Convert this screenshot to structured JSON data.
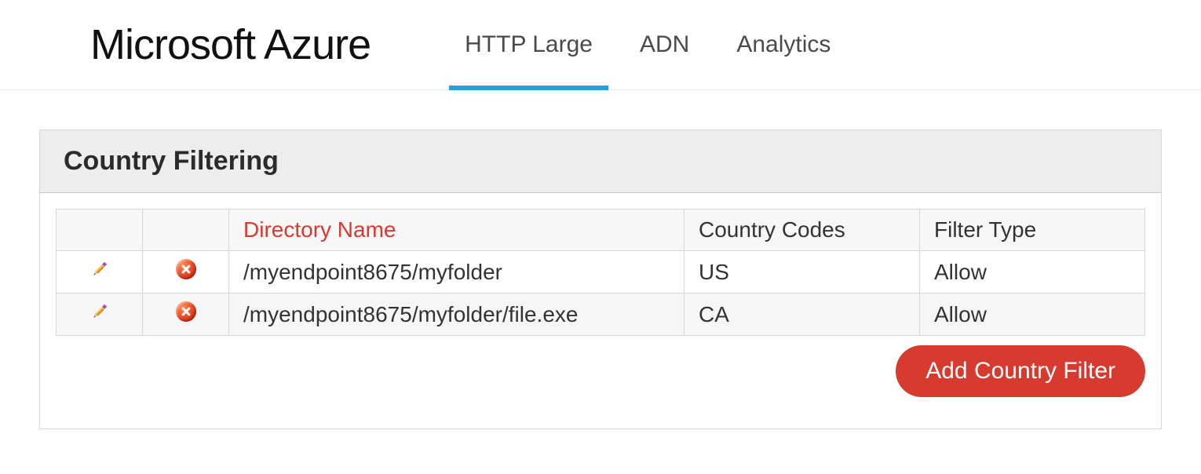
{
  "brand": "Microsoft Azure",
  "nav": {
    "tabs": [
      {
        "label": "HTTP Large",
        "active": true
      },
      {
        "label": "ADN",
        "active": false
      },
      {
        "label": "Analytics",
        "active": false
      }
    ]
  },
  "panel": {
    "title": "Country Filtering"
  },
  "table": {
    "columns": {
      "directory_name": "Directory Name",
      "country_codes": "Country Codes",
      "filter_type": "Filter Type"
    },
    "rows": [
      {
        "directory": "/myendpoint8675/myfolder",
        "country_codes": "US",
        "filter_type": "Allow"
      },
      {
        "directory": "/myendpoint8675/myfolder/file.exe",
        "country_codes": "CA",
        "filter_type": "Allow"
      }
    ]
  },
  "actions": {
    "add_filter_label": "Add Country Filter"
  }
}
